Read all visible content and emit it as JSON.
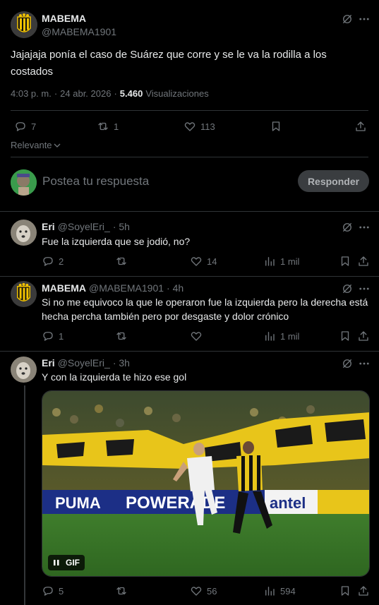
{
  "main_post": {
    "author_name": "MABEMA",
    "author_handle": "@MABEMA1901",
    "text_line1": "Jajajaja ponía el caso de Suárez que corre y se le va la rodilla a los",
    "text_line2": "costados",
    "time": "4:03 p. m.",
    "separator": "·",
    "date": "24 abr. 2026",
    "views_count": "5.460",
    "views_label": "Visualizaciones",
    "replies": "7",
    "reposts": "1",
    "likes": "113"
  },
  "sort": {
    "label": "Relevante"
  },
  "composer": {
    "placeholder": "Postea tu respuesta",
    "button_label": "Responder"
  },
  "replies": [
    {
      "name": "Eri",
      "handle": "@SoyelEri_",
      "time": "· 5h",
      "text": "Fue la izquierda que se jodió, no?",
      "replies": "2",
      "reposts": "",
      "likes": "14",
      "views": "1 mil"
    },
    {
      "name": "MABEMA",
      "handle": "@MABEMA1901",
      "time": "· 4h",
      "text_line1": "Si no me equivoco la que le operaron fue la izquierda pero la derecha está",
      "text_line2": "hecha percha también pero por desgaste y dolor crónico",
      "replies": "1",
      "reposts": "",
      "likes": "",
      "views": "1 mil"
    },
    {
      "name": "Eri",
      "handle": "@SoyelEri_",
      "time": "· 3h",
      "text": "Y con la izquierda te hizo ese gol",
      "gif_label": "GIF",
      "media_ads": [
        "PUMA",
        "POWERADE",
        "antel"
      ],
      "replies": "5",
      "reposts": "",
      "likes": "56",
      "views": "594"
    }
  ],
  "colors": {
    "background": "#000000",
    "text": "#e7e9ea",
    "muted": "#71767b",
    "divider": "#2f3336",
    "button_bg": "#3a3d40",
    "avatar_peñarol_yellow": "#f2c200"
  }
}
